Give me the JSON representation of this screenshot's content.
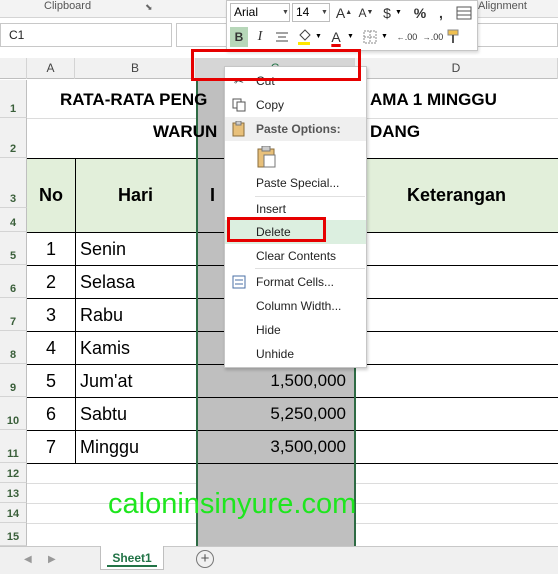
{
  "ribbon": {
    "clipboard_label": "Clipboard",
    "alignment_label": "Alignment"
  },
  "formula_bar": {
    "name_box": "C1"
  },
  "columns": [
    "A",
    "B",
    "C",
    "D"
  ],
  "rows": [
    "1",
    "2",
    "3",
    "4",
    "5",
    "6",
    "7",
    "8",
    "9",
    "10",
    "11",
    "12",
    "13",
    "14",
    "15"
  ],
  "sheet": {
    "title_line1_left": "RATA-RATA PENG",
    "title_line1_right": "AMA 1 MINGGU",
    "title_line2_left": "WARUN",
    "title_line2_right": "DANG",
    "header_no": "No",
    "header_hari": "Hari",
    "header_c": "I",
    "header_keterangan": "Keterangan",
    "data_rows": [
      {
        "no": "1",
        "hari": "Senin",
        "value": ""
      },
      {
        "no": "2",
        "hari": "Selasa",
        "value": ""
      },
      {
        "no": "3",
        "hari": "Rabu",
        "value": ""
      },
      {
        "no": "4",
        "hari": "Kamis",
        "value": ""
      },
      {
        "no": "5",
        "hari": "Jum'at",
        "value": "1,500,000"
      },
      {
        "no": "6",
        "hari": "Sabtu",
        "value": "5,250,000"
      },
      {
        "no": "7",
        "hari": "Minggu",
        "value": "3,500,000"
      }
    ]
  },
  "mini_toolbar": {
    "font_name": "Arial",
    "font_size": "14",
    "grow_font": "A",
    "shrink_font": "A",
    "currency": "$",
    "percent": "%",
    "comma": ",",
    "bold": "B",
    "italic": "I",
    "font_color": "A",
    "inc_decimal": ".00",
    "dec_decimal": ".00",
    "accent_color": "#e60000"
  },
  "context_menu": {
    "cut": "Cut",
    "copy": "Copy",
    "paste_options": "Paste Options:",
    "paste_special": "Paste Special...",
    "insert": "Insert",
    "delete": "Delete",
    "clear_contents": "Clear Contents",
    "format_cells": "Format Cells...",
    "column_width": "Column Width...",
    "hide": "Hide",
    "unhide": "Unhide"
  },
  "tabs": {
    "sheet1": "Sheet1"
  },
  "watermark": "caloninsinyure.com",
  "colors": {
    "header_fill": "#e2efda",
    "selection_fill": "#bfbfbf",
    "highlight_red": "#e60000",
    "watermark_green": "#1ee61e",
    "excel_green": "#217346"
  }
}
